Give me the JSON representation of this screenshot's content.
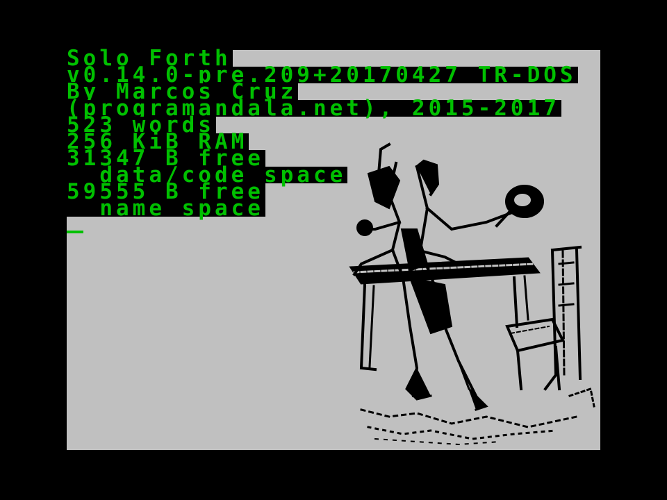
{
  "screen": {
    "border_color": "#000000",
    "paper_color": "#c0c0c0",
    "ink_color": "#00c000"
  },
  "console": {
    "lines": [
      "Solo Forth",
      "v0.14.0-pre.209+20170427 TR-DOS",
      "By Marcos Cruz",
      "(programandala.net), 2015-2017",
      "523 words",
      "256 KiB RAM",
      "31347 B free",
      "  data/code space",
      "59555 B free",
      "  name space"
    ]
  },
  "illustration": {
    "subject": "engraving of a man with a fan standing by a table and chair"
  }
}
